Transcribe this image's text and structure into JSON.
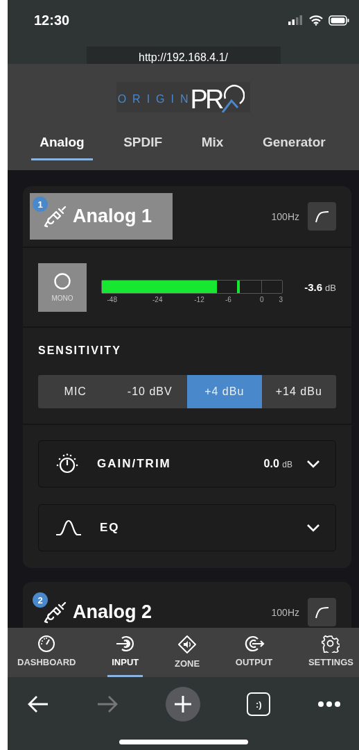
{
  "status_bar": {
    "time": "12:30"
  },
  "browser": {
    "url": "http://192.168.4.1/"
  },
  "logo": {
    "brand": "ORIGIN",
    "suffix": "PR"
  },
  "tabs": [
    {
      "label": "Analog",
      "selected": true
    },
    {
      "label": "SPDIF",
      "selected": false
    },
    {
      "label": "Mix",
      "selected": false
    },
    {
      "label": "Generator",
      "selected": false
    }
  ],
  "channels": [
    {
      "number": "1",
      "name": "Analog 1",
      "filter": "100Hz",
      "mono": {
        "label": "MONO"
      },
      "meter": {
        "level": 0.64,
        "peak": {
          "level": 0.75
        },
        "scale": [
          "-48",
          "-24",
          "-12",
          "-6",
          "0",
          "3"
        ],
        "reading": "-3.6",
        "unit": "dB"
      },
      "sensitivity": {
        "title": "SENSITIVITY",
        "options": [
          {
            "label": "MIC",
            "selected": false
          },
          {
            "label": "-10 dBV",
            "selected": false
          },
          {
            "label": "+4 dBu",
            "selected": true
          },
          {
            "label": "+14 dBu",
            "selected": false
          }
        ]
      },
      "sections": [
        {
          "kind": "gain",
          "label": "GAIN/TRIM",
          "value": "0.0",
          "unit": "dB",
          "expanded": false
        },
        {
          "kind": "eq",
          "label": "EQ",
          "expanded": false
        }
      ]
    },
    {
      "number": "2",
      "name": "Analog 2",
      "filter": "100Hz"
    }
  ],
  "nav": [
    {
      "label": "DASHBOARD",
      "selected": false
    },
    {
      "label": "INPUT",
      "selected": true
    },
    {
      "label": "ZONE",
      "selected": false
    },
    {
      "label": "OUTPUT",
      "selected": false
    },
    {
      "label": "SETTINGS",
      "selected": false
    }
  ],
  "toolbar": {
    "forward_disabled": true,
    "tabs_label": ":)"
  }
}
